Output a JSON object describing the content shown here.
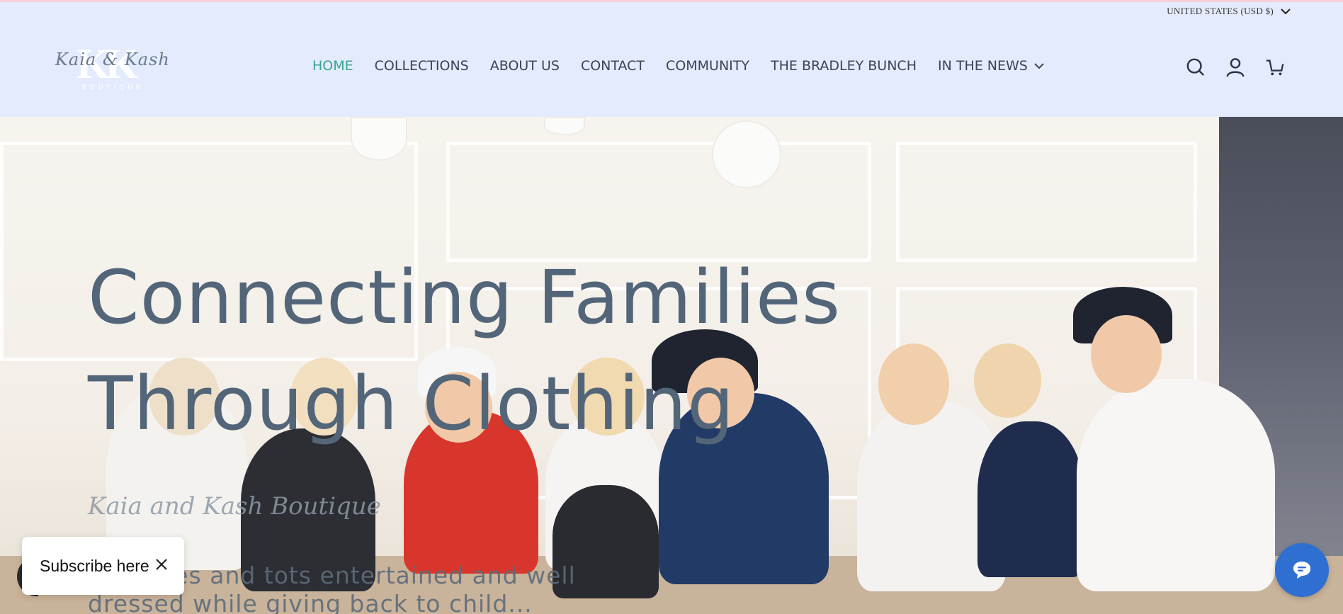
{
  "header": {
    "currency": "UNITED STATES (USD $)",
    "logo": {
      "monogram": "KK",
      "script": "Kaia & Kash",
      "sub": "BOUTIQUE"
    },
    "nav": [
      {
        "label": "HOME",
        "active": true
      },
      {
        "label": "COLLECTIONS",
        "active": false
      },
      {
        "label": "ABOUT US",
        "active": false
      },
      {
        "label": "CONTACT",
        "active": false
      },
      {
        "label": "COMMUNITY",
        "active": false
      },
      {
        "label": "THE BRADLEY BUNCH",
        "active": false
      },
      {
        "label": "IN THE NEWS",
        "active": false,
        "has_dropdown": true
      }
    ],
    "icons": [
      "search-icon",
      "account-icon",
      "cart-icon"
    ]
  },
  "hero": {
    "title": "Connecting Families Through Clothing",
    "script": "Kaia and Kash Boutique",
    "text": "... babies and tots entertained and well dressed while giving back to child..."
  },
  "subscribe": {
    "label": "Subscribe here"
  },
  "chat": {
    "icon": "chat-icon"
  },
  "colors": {
    "header_bg": "#e3ebfd",
    "active_nav": "#3ea58f",
    "title": "#536578",
    "chat": "#2f6fd1"
  }
}
